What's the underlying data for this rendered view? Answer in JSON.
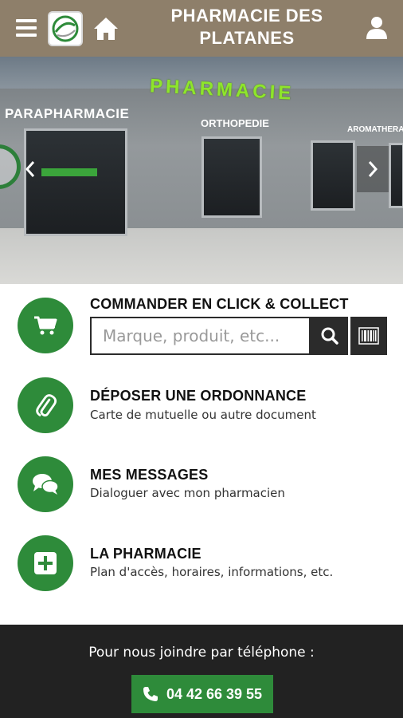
{
  "header": {
    "title": "PHARMACIE DES PLATANES",
    "icons": [
      "hamburger-menu-icon",
      "logo",
      "home-icon",
      "user-icon"
    ]
  },
  "carousel": {
    "signs": {
      "pharmacie": "PHARMACIE",
      "parapharmacie": "PARAPHARMACIE",
      "orthopedie": "ORTHOPEDIE",
      "aromatherapie": "AROMATHERAPIE"
    }
  },
  "menu": {
    "click_collect": {
      "title": "COMMANDER EN CLICK & COLLECT",
      "search_placeholder": "Marque, produit, etc...",
      "icon": "cart-icon"
    },
    "ordonnance": {
      "title": "DÉPOSER UNE ORDONNANCE",
      "subtitle": "Carte de mutuelle ou autre document",
      "icon": "paperclip-icon"
    },
    "messages": {
      "title": "MES MESSAGES",
      "subtitle": "Dialoguer avec mon pharmacien",
      "icon": "chat-bubbles-icon"
    },
    "pharmacie": {
      "title": "LA PHARMACIE",
      "subtitle": "Plan d'accès, horaires, informations, etc.",
      "icon": "plus-square-icon"
    }
  },
  "footer": {
    "label": "Pour nous joindre par téléphone :",
    "phone": "04 42 66 39 55"
  },
  "colors": {
    "header_bg": "#8e7f6a",
    "accent_green": "#2e8b3a",
    "footer_bg": "#222222"
  }
}
